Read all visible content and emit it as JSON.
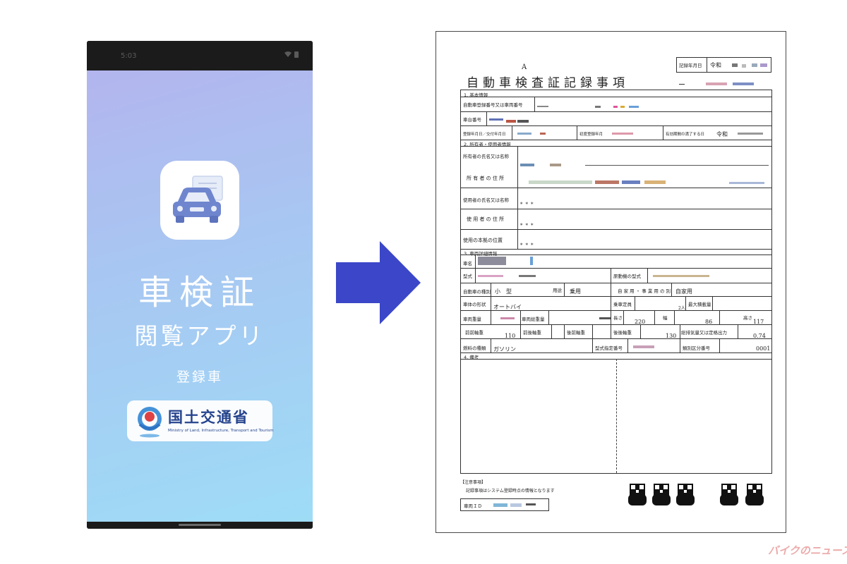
{
  "phone": {
    "status_time": "5:03",
    "title_line1": "車検証",
    "title_line2": "閲覧アプリ",
    "subtitle": "登録車",
    "ministry_name": "国土交通省",
    "ministry_english": "Ministry of Land, Infrastructure, Transport and Tourism",
    "gradient_colors": [
      "#b3b5ee",
      "#a7c8f2",
      "#9edcf6"
    ]
  },
  "arrow": {
    "color": "#3b47c8"
  },
  "document": {
    "mark": "A",
    "title": "自動車検査証記録事項",
    "record_date_label": "記録年月日",
    "record_date_value": "令和",
    "sections": {
      "basic": "1. 基本情報",
      "owner": "2. 所有者・使用者情報",
      "vehicle": "3. 車両詳細情報",
      "remarks": "4. 備考"
    },
    "labels": {
      "reg_number": "自動車登録番号又は車両番号",
      "chassis_number": "車台番号",
      "reg_date": "登録年月日／交付年月日",
      "first_reg": "初度登録年月",
      "expiry": "有効期間の満了する日",
      "owner_name": "所有者の氏名又は名称",
      "owner_address": "所 有 者 の 住 所",
      "user_name": "使用者の氏名又は名称",
      "user_address": "使 用 者 の 住 所",
      "base_location": "使用の本拠の位置",
      "car_name": "車名",
      "model": "型式",
      "engine_model": "原動機の型式",
      "vehicle_type": "自動車の種別",
      "usage": "用途",
      "private_business": "自 家 用 ・ 事 業 用 の 別",
      "body_shape": "車体の形状",
      "capacity": "乗車定員",
      "max_load": "最大積載量",
      "weight": "車両重量",
      "gross_weight": "車両総重量",
      "length": "長さ",
      "width": "幅",
      "height": "高さ",
      "front_axle": "前前軸重",
      "front_rear_axle": "前後軸重",
      "rear_front_axle": "後前軸重",
      "rear_rear_axle": "後後軸重",
      "displacement": "総排気量又は定格出力",
      "fuel_type": "燃料の種類",
      "type_designation": "型式指定番号",
      "category_number": "類別区分番号"
    },
    "values": {
      "expiry_prefix": "令和",
      "user_name_mask": "***",
      "user_address_mask": "***",
      "base_location_mask": "***",
      "vehicle_type": "小　型",
      "usage": "乗用",
      "private_business": "自家用",
      "body_shape": "オートバイ",
      "capacity_unit": "2人",
      "weight_value": "",
      "length": "220",
      "width": "86",
      "height": "117",
      "front_axle": "110",
      "rear_rear_axle": "130",
      "displacement": "0.74",
      "fuel_type": "ガソリン",
      "category_number": "0001"
    },
    "notes_title": "【注意事項】",
    "notes_text": "記録事項はシステム登録時点の情報となります",
    "vehicle_id_label": "車両ＩＤ"
  },
  "watermark": "バイクのニュース"
}
